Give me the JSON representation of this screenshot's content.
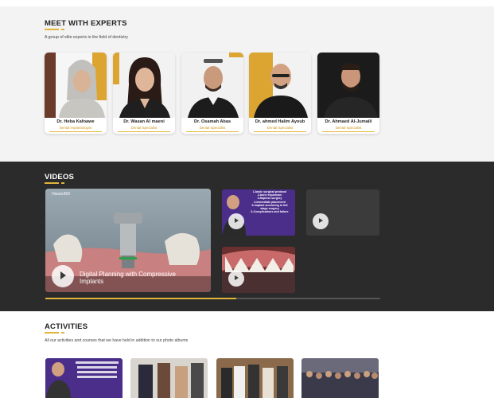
{
  "experts": {
    "title": "MEET WITH EXPERTS",
    "subtitle": "A group of elite experts in the field of dentistry",
    "cards": [
      {
        "name": "Dr. Heba Kafoawe",
        "role": "Dental implantologist"
      },
      {
        "name": "Dr. Wasan Al maeni",
        "role": "Dental Specialist"
      },
      {
        "name": "Dr. Osamah Abas",
        "role": "Dental Specialist"
      },
      {
        "name": "Dr. ahmed Halim Ayoub",
        "role": "Dental Specialist"
      },
      {
        "name": "Dr. Ahmaed Al-Jumaili",
        "role": "Dental Specialist"
      }
    ]
  },
  "videos": {
    "title": "VIDEOS",
    "main_title": "Digital Planning with Compressive Implants",
    "brand": "Osseo360",
    "thumb_lines": [
      "1-basic surgical protocol",
      "2-bone expansion",
      "3-flapless surgery",
      "4-immediate placement",
      "5-implant anchoring in full",
      "stage surgery",
      "6-Complications and failure"
    ],
    "progress": 0.57
  },
  "activities": {
    "title": "ACTIVITIES",
    "subtitle": "All our activities and courses that we have held in addition to our photo albums"
  },
  "colors": {
    "accent": "#e3b43a",
    "dark": "#2b2b2b"
  }
}
